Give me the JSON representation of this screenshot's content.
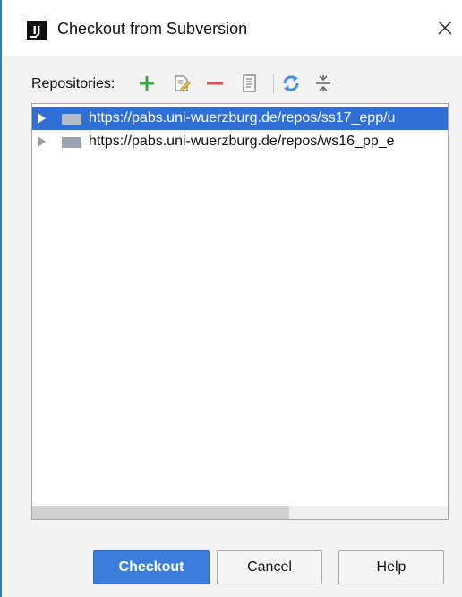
{
  "window": {
    "title": "Checkout from Subversion",
    "app_icon_glyph": "IJ",
    "close_icon": "close-icon"
  },
  "toolbar": {
    "label": "Repositories:",
    "buttons": [
      {
        "name": "add-icon",
        "color": "#3aa845"
      },
      {
        "name": "edit-icon",
        "color": "#7a7a7a"
      },
      {
        "name": "remove-icon",
        "color": "#d9534f"
      },
      {
        "name": "browse-changes-icon",
        "color": "#7a7a7a"
      },
      {
        "name": "refresh-icon",
        "color": "#4a90d9"
      },
      {
        "name": "collapse-all-icon",
        "color": "#7a7a7a"
      }
    ]
  },
  "repositories": [
    {
      "url": "https://pabs.uni-wuerzburg.de/repos/ss17_epp/u",
      "selected": true
    },
    {
      "url": "https://pabs.uni-wuerzburg.de/repos/ws16_pp_e",
      "selected": false
    }
  ],
  "buttons": {
    "checkout": "Checkout",
    "cancel": "Cancel",
    "help": "Help"
  },
  "colors": {
    "accent": "#3b7ddd",
    "selection": "#2f6fd6",
    "window_border": "#2d7ed2"
  }
}
